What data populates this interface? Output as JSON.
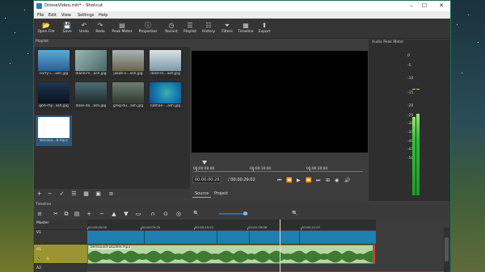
{
  "window": {
    "title": "DroneVideo.mlt* - Shotcut"
  },
  "window_controls": {
    "minimize": "–",
    "maximize": "☐",
    "close": "✕"
  },
  "menu": [
    "File",
    "Edit",
    "View",
    "Settings",
    "Help"
  ],
  "toolbar": [
    {
      "label": "Open File",
      "icon": "folder-open-icon",
      "glyph": "📂"
    },
    {
      "label": "Save",
      "icon": "save-icon",
      "glyph": "💾"
    },
    {
      "label": "Undo",
      "icon": "undo-icon",
      "glyph": "↶"
    },
    {
      "label": "Redo",
      "icon": "redo-icon",
      "glyph": "↷"
    },
    {
      "label": "Peak Meter",
      "icon": "peak-meter-icon",
      "glyph": "▤"
    },
    {
      "label": "Properties",
      "icon": "properties-icon",
      "glyph": "ⓘ"
    },
    {
      "label": "Recent",
      "icon": "recent-icon",
      "glyph": "◷"
    },
    {
      "label": "Playlist",
      "icon": "playlist-icon",
      "glyph": "☰"
    },
    {
      "label": "History",
      "icon": "history-icon",
      "glyph": "☷"
    },
    {
      "label": "Filters",
      "icon": "filters-icon",
      "glyph": "⏷"
    },
    {
      "label": "Timeline",
      "icon": "timeline-icon",
      "glyph": "▦"
    },
    {
      "label": "Export",
      "icon": "export-icon",
      "glyph": "⬆"
    }
  ],
  "playlist": {
    "title": "Playlist",
    "items": [
      {
        "caption": "corry-i....ash.jpg",
        "color": "#3b79b8"
      },
      {
        "caption": "diane-m...ash.jpg",
        "color": "#6a8f93"
      },
      {
        "caption": "jakob-o...ash.jpg",
        "color": "#7c7a63"
      },
      {
        "caption": "dose-m...ash.jpg",
        "color": "#a9b7c3"
      },
      {
        "caption": "goh-rhy...ash.jpg",
        "color": "#152536"
      },
      {
        "caption": "dose-da...ash.jpg",
        "color": "#31474d"
      },
      {
        "caption": "greg-du...ash.jpg",
        "color": "#4d5a4e"
      },
      {
        "caption": "nathan-...ash.jpg",
        "color": "#1b73a3"
      },
      {
        "caption": "bensou...b.mp3",
        "color": "#ffffff"
      }
    ],
    "buttons": [
      {
        "name": "add-button",
        "glyph": "+"
      },
      {
        "name": "remove-button",
        "glyph": "−"
      },
      {
        "name": "update-button",
        "glyph": "✓"
      },
      {
        "name": "view-details-button",
        "glyph": "☰"
      },
      {
        "name": "view-tiles-button",
        "glyph": "▦"
      },
      {
        "name": "view-icons-button",
        "glyph": "▣"
      },
      {
        "name": "menu-button",
        "glyph": "≡"
      }
    ]
  },
  "player": {
    "ruler_labels": [
      "00:00:00:00",
      "00:00:10:00",
      "00:00:20:00"
    ],
    "current_time": "00:00:00:29",
    "total_time": "/ 00:00:29:02",
    "tabs": [
      "Source",
      "Project"
    ],
    "transport": [
      {
        "name": "skip-start-button",
        "glyph": "⏮"
      },
      {
        "name": "rewind-button",
        "glyph": "⏪"
      },
      {
        "name": "play-button",
        "glyph": "▶"
      },
      {
        "name": "fast-forward-button",
        "glyph": "⏩"
      },
      {
        "name": "skip-end-button",
        "glyph": "⏭"
      },
      {
        "name": "toggle-grid-button",
        "glyph": "⊞"
      },
      {
        "name": "zoom-button",
        "glyph": "◉"
      },
      {
        "name": "volume-button",
        "glyph": "🔊"
      }
    ]
  },
  "meter": {
    "title": "Audio Peak Meter",
    "scale": [
      "0",
      "-5",
      "-10",
      "-15",
      "-20",
      "-25",
      "-30",
      "-35",
      "-40",
      "-45",
      "-50"
    ]
  },
  "timeline": {
    "title": "Timeline",
    "tool_glyphs": [
      "≡",
      "✂",
      "⧉",
      "▤",
      "+",
      "−",
      "▲",
      "▼",
      "▭",
      "∩",
      "⊙",
      "◎",
      "🔍",
      "🔍"
    ],
    "tool_names": [
      "menu-icon",
      "cut-icon",
      "copy-icon",
      "paste-icon",
      "append-icon",
      "ripple-delete-icon",
      "lift-icon",
      "overwrite-icon",
      "split-icon",
      "snap-icon",
      "scrub-icon",
      "ripple-icon",
      "zoom-out-icon",
      "zoom-in-icon"
    ],
    "ruler_labels": [
      "00:00:00:00",
      "00:00:05:20",
      "00:00:10:21",
      "00:00:16:06",
      "00:00:21:07"
    ],
    "tracks": [
      {
        "name": "Master"
      },
      {
        "name": "V1"
      },
      {
        "name": "A1"
      },
      {
        "name": "A2"
      }
    ],
    "audio_clip": "bensound-ukulele.mp3"
  }
}
